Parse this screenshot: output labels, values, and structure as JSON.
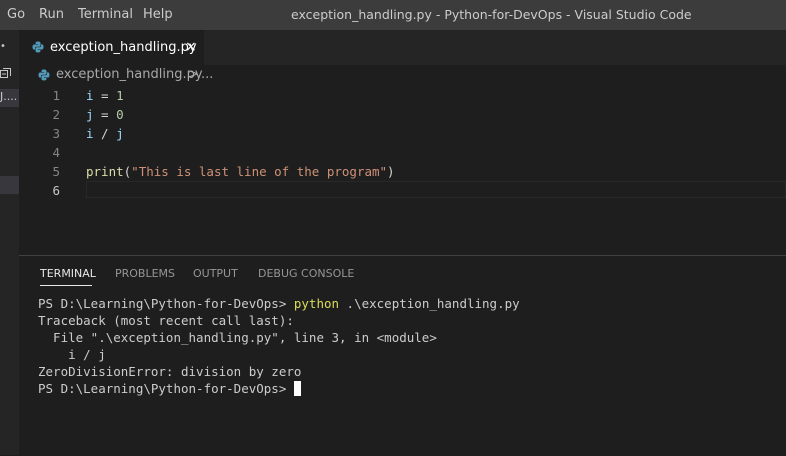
{
  "titlebar": {
    "menu": [
      "Go",
      "Run",
      "Terminal",
      "Help"
    ],
    "window_title": "exception_handling.py - Python-for-DevOps - Visual Studio Code"
  },
  "sidebar": {
    "partial_label": "J...."
  },
  "tab": {
    "label": "exception_handling.py",
    "close": "×",
    "icon": "python-icon"
  },
  "breadcrumb": {
    "file": "exception_handling.py",
    "separator": ">",
    "rest": "..."
  },
  "editor": {
    "lines": [
      {
        "n": "1",
        "tokens": [
          [
            "var",
            "i"
          ],
          [
            "op",
            " = "
          ],
          [
            "num",
            "1"
          ]
        ]
      },
      {
        "n": "2",
        "tokens": [
          [
            "var",
            "j"
          ],
          [
            "op",
            " = "
          ],
          [
            "num",
            "0"
          ]
        ]
      },
      {
        "n": "3",
        "tokens": [
          [
            "var",
            "i"
          ],
          [
            "op",
            " / "
          ],
          [
            "var",
            "j"
          ]
        ]
      },
      {
        "n": "4",
        "tokens": []
      },
      {
        "n": "5",
        "tokens": [
          [
            "fn",
            "print"
          ],
          [
            "op",
            "("
          ],
          [
            "str",
            "\"This is last line of the program\""
          ],
          [
            "op",
            ")"
          ]
        ]
      },
      {
        "n": "6",
        "tokens": []
      }
    ],
    "active_line": "6"
  },
  "panel": {
    "tabs": [
      "TERMINAL",
      "PROBLEMS",
      "OUTPUT",
      "DEBUG CONSOLE"
    ],
    "active_tab": "TERMINAL"
  },
  "terminal": {
    "prompt": "PS D:\\Learning\\Python-for-DevOps> ",
    "command": "python",
    "args": " .\\exception_handling.py",
    "output": [
      "Traceback (most recent call last):",
      "  File \".\\exception_handling.py\", line 3, in <module>",
      "    i / j",
      "ZeroDivisionError: division by zero"
    ],
    "final_prompt": "PS D:\\Learning\\Python-for-DevOps> "
  },
  "colors": {
    "titlebar": "#3c3c3c",
    "editor_bg": "#1e1e1e",
    "tabbar_bg": "#252526",
    "python_icon": "#519aba"
  }
}
